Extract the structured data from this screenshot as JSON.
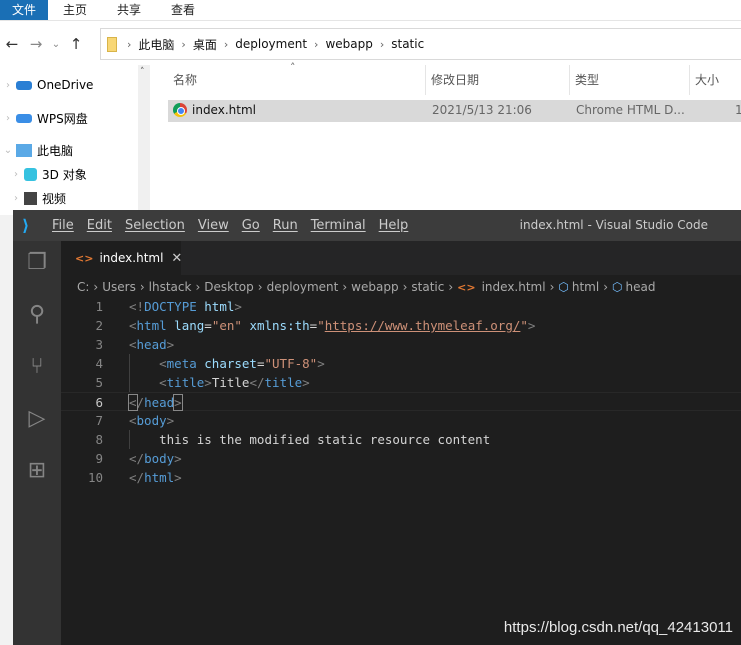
{
  "explorer": {
    "ribbon_tabs": [
      "文件",
      "主页",
      "共享",
      "查看"
    ],
    "breadcrumb": [
      "此电脑",
      "桌面",
      "deployment",
      "webapp",
      "static"
    ],
    "nav_items": [
      {
        "label": "OneDrive",
        "icon": "onedrive-cloud-icon"
      },
      {
        "label": "WPS网盘",
        "icon": "wps-cloud-icon"
      },
      {
        "label": "此电脑",
        "icon": "computer-icon"
      },
      {
        "label": "3D 对象",
        "icon": "3d-objects-icon"
      },
      {
        "label": "视频",
        "icon": "video-icon"
      }
    ],
    "columns": [
      "名称",
      "修改日期",
      "类型",
      "大小"
    ],
    "files": [
      {
        "name": "index.html",
        "modified": "2021/5/13 21:06",
        "type": "Chrome HTML D...",
        "size": "1"
      }
    ]
  },
  "vscode": {
    "menu": [
      "File",
      "Edit",
      "Selection",
      "View",
      "Go",
      "Run",
      "Terminal",
      "Help"
    ],
    "window_title": "index.html - Visual Studio Code",
    "tab": "index.html",
    "breadcrumb": [
      "C:",
      "Users",
      "lhstack",
      "Desktop",
      "deployment",
      "webapp",
      "static",
      "index.html",
      "html",
      "head"
    ],
    "current_line": 6,
    "lines": [
      [
        [
          "<!",
          "p"
        ],
        [
          "DOCTYPE",
          "tag"
        ],
        [
          " ",
          "txt"
        ],
        [
          "html",
          "attr"
        ],
        [
          ">",
          "p"
        ]
      ],
      [
        [
          "<",
          "p"
        ],
        [
          "html",
          "tag"
        ],
        [
          " lang",
          "attr"
        ],
        [
          "=",
          "txt"
        ],
        [
          "\"en\"",
          "str"
        ],
        [
          " xmlns:th",
          "attr"
        ],
        [
          "=",
          "txt"
        ],
        [
          "\"",
          "str"
        ],
        [
          "https://www.thymeleaf.org/",
          "url"
        ],
        [
          "\"",
          "str"
        ],
        [
          ">",
          "p"
        ]
      ],
      [
        [
          "<",
          "p"
        ],
        [
          "head",
          "tag"
        ],
        [
          ">",
          "p"
        ]
      ],
      [
        [
          "    <",
          "p"
        ],
        [
          "meta",
          "tag"
        ],
        [
          " charset",
          "attr"
        ],
        [
          "=",
          "txt"
        ],
        [
          "\"UTF-8\"",
          "str"
        ],
        [
          ">",
          "p"
        ]
      ],
      [
        [
          "    <",
          "p"
        ],
        [
          "title",
          "tag"
        ],
        [
          ">",
          "p"
        ],
        [
          "Title",
          "txt"
        ],
        [
          "</",
          "p"
        ],
        [
          "title",
          "tag"
        ],
        [
          ">",
          "p"
        ]
      ],
      [
        [
          "<",
          "br"
        ],
        [
          "/",
          "p"
        ],
        [
          "head",
          "tag"
        ],
        [
          ">",
          "br"
        ]
      ],
      [
        [
          "<",
          "p"
        ],
        [
          "body",
          "tag"
        ],
        [
          ">",
          "p"
        ]
      ],
      [
        [
          "    this is the modified static resource content",
          "txt"
        ]
      ],
      [
        [
          "</",
          "p"
        ],
        [
          "body",
          "tag"
        ],
        [
          ">",
          "p"
        ]
      ],
      [
        [
          "</",
          "p"
        ],
        [
          "html",
          "tag"
        ],
        [
          ">",
          "p"
        ]
      ]
    ]
  },
  "watermark": "https://blog.csdn.net/qq_42413011"
}
